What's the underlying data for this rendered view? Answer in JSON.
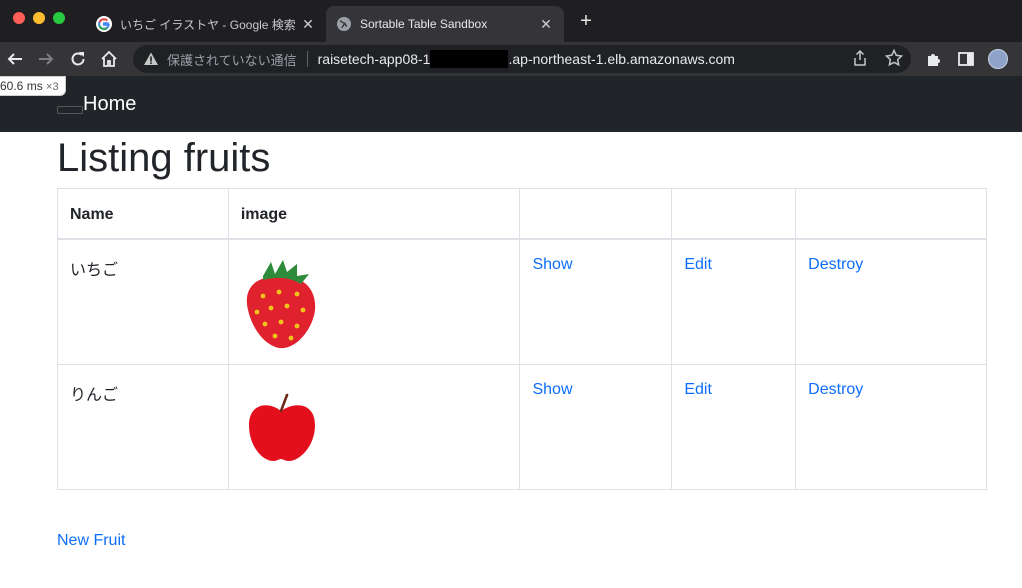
{
  "browser": {
    "tabs": [
      {
        "title": "いちご イラストヤ - Google 検索",
        "close": "✕"
      },
      {
        "title": "Sortable Table Sandbox",
        "close": "✕"
      }
    ],
    "new_tab": "+",
    "security_label": "保護されていない通信",
    "url_prefix": "raisetech-app08-1",
    "url_suffix": ".ap-northeast-1.elb.amazonaws.com",
    "perf_value": "60.6",
    "perf_unit": "ms",
    "perf_multiplier": "×3"
  },
  "navbar": {
    "brand": "Home"
  },
  "page": {
    "title": "Listing fruits",
    "new_link": "New Fruit"
  },
  "table": {
    "headers": [
      "Name",
      "image",
      "",
      "",
      ""
    ],
    "rows": [
      {
        "name": "いちご",
        "fruit": "strawberry",
        "show": "Show",
        "edit": "Edit",
        "destroy": "Destroy"
      },
      {
        "name": "りんご",
        "fruit": "apple",
        "show": "Show",
        "edit": "Edit",
        "destroy": "Destroy"
      }
    ]
  },
  "colors": {
    "link": "#0d6efd",
    "navbar": "#212529",
    "strawberry": "#e0212e",
    "apple": "#e30f1c"
  }
}
